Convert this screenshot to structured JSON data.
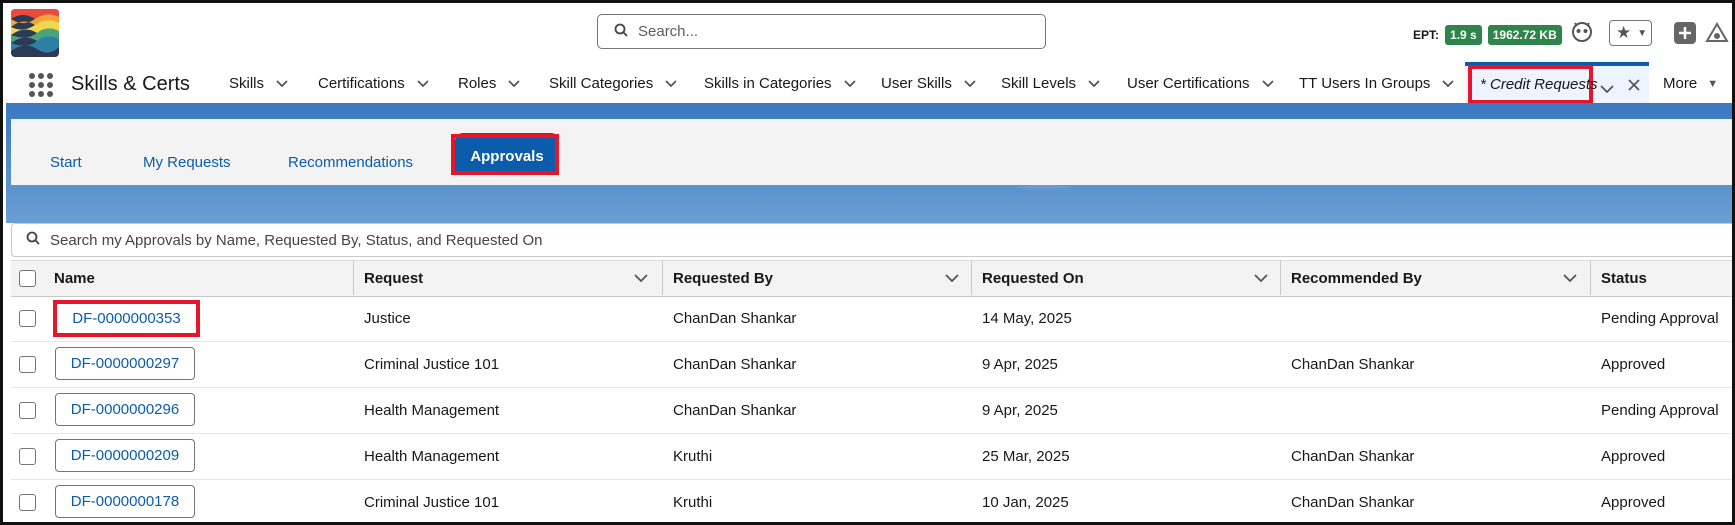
{
  "header": {
    "search_placeholder": "Search...",
    "ept_label": "EPT:",
    "ept_time": "1.9 s",
    "ept_size": "1962.72 KB"
  },
  "nav": {
    "app_name": "Skills & Certs",
    "items": [
      {
        "label": "Skills"
      },
      {
        "label": "Certifications"
      },
      {
        "label": "Roles"
      },
      {
        "label": "Skill Categories"
      },
      {
        "label": "Skills in Categories"
      },
      {
        "label": "User Skills"
      },
      {
        "label": "Skill Levels"
      },
      {
        "label": "User Certifications"
      },
      {
        "label": "TT Users In Groups"
      }
    ],
    "active_tab": "* Credit Requests",
    "more_label": "More"
  },
  "subtabs": {
    "start": "Start",
    "my_requests": "My Requests",
    "recommendations": "Recommendations",
    "approvals": "Approvals"
  },
  "table": {
    "search_placeholder": "Search my Approvals by Name, Requested By, Status, and Requested On",
    "columns": [
      "Name",
      "Request",
      "Requested By",
      "Requested On",
      "Recommended By",
      "Status"
    ],
    "rows": [
      {
        "name": "DF-0000000353",
        "request": "Justice",
        "requested_by": "ChanDan Shankar",
        "requested_on": "14 May, 2025",
        "recommended_by": "",
        "status": "Pending Approval"
      },
      {
        "name": "DF-0000000297",
        "request": "Criminal Justice 101",
        "requested_by": "ChanDan Shankar",
        "requested_on": "9 Apr, 2025",
        "recommended_by": "ChanDan Shankar",
        "status": "Approved"
      },
      {
        "name": "DF-0000000296",
        "request": "Health Management",
        "requested_by": "ChanDan Shankar",
        "requested_on": "9 Apr, 2025",
        "recommended_by": "",
        "status": "Pending Approval"
      },
      {
        "name": "DF-0000000209",
        "request": "Health Management",
        "requested_by": "Kruthi",
        "requested_on": "25 Mar, 2025",
        "recommended_by": "ChanDan Shankar",
        "status": "Approved"
      },
      {
        "name": "DF-0000000178",
        "request": "Criminal Justice 101",
        "requested_by": "Kruthi",
        "requested_on": "10 Jan, 2025",
        "recommended_by": "ChanDan Shankar",
        "status": "Approved"
      }
    ]
  }
}
